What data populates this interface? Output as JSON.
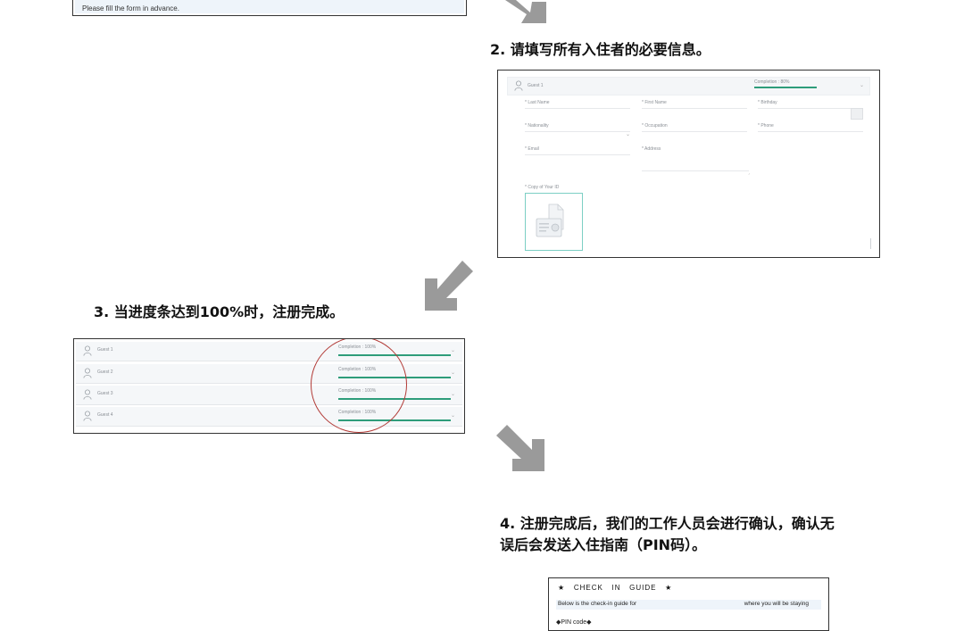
{
  "colors": {
    "arrow": "#9a9a9a",
    "progress_bar": "#2e9d7a",
    "highlight_circle": "#b23a36",
    "field_bg": "#eef4fa"
  },
  "step1": {
    "note": "Please fill the form in advance."
  },
  "step2": {
    "title": "2. 请填写所有入住者的必要信息。",
    "guest_label": "Guest 1",
    "completion_label": "Completion : 80%",
    "completion": 0.8,
    "fields": [
      {
        "label": "* Last Name"
      },
      {
        "label": "* First Name"
      },
      {
        "label": "* Birthday"
      },
      {
        "label": "* Nationality"
      },
      {
        "label": "* Occupation"
      },
      {
        "label": "* Phone"
      },
      {
        "label": "* Email"
      },
      {
        "label": "* Address"
      }
    ],
    "upload_label": "* Copy of Your ID",
    "icons": [
      "person-icon",
      "calendar-icon",
      "chevron-down-icon",
      "id-card-icon"
    ]
  },
  "step3": {
    "title": "3. 当进度条达到100%时，注册完成。",
    "guests": [
      {
        "name": "Guest 1",
        "completion_label": "Completion : 100%",
        "completion": 1.0
      },
      {
        "name": "Guest 2",
        "completion_label": "Completion : 100%",
        "completion": 1.0
      },
      {
        "name": "Guest 3",
        "completion_label": "Completion : 100%",
        "completion": 1.0
      },
      {
        "name": "Guest 4",
        "completion_label": "Completion : 100%",
        "completion": 1.0
      }
    ]
  },
  "step4": {
    "title_line1": "4. 注册完成后，我们的工作人员会进行确认，确认无",
    "title_line2": "误后会发送入住指南（PIN码）。",
    "guide_title": "★   CHECK   IN   GUIDE   ★",
    "below_text": "Below is the check-in guide for",
    "staying_text": "where you will be staying",
    "pin_label": "◆PIN code◆"
  }
}
